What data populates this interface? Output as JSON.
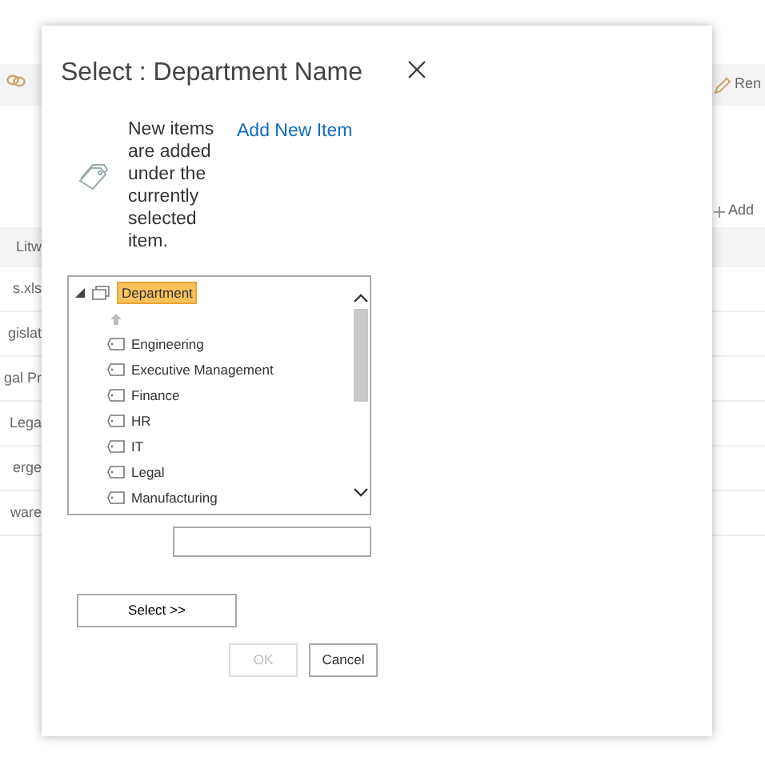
{
  "background": {
    "toolbar": {
      "right_label": "Ren"
    },
    "add_label": "Add",
    "header_label": "Litw",
    "rows": [
      "s.xls",
      "gislat",
      "gal Pr",
      "Lega",
      "erge",
      "ware"
    ]
  },
  "dialog": {
    "title": "Select : Department Name",
    "info_text": "New items are added under the currently selected item.",
    "add_link": "Add New Item",
    "tree": {
      "label": "Department",
      "expanded": true,
      "selected": true,
      "children": [
        {
          "label": "Engineering",
          "selected": false
        },
        {
          "label": "Executive Management",
          "selected": false
        },
        {
          "label": "Finance",
          "selected": false
        },
        {
          "label": "HR",
          "selected": false
        },
        {
          "label": "IT",
          "selected": false
        },
        {
          "label": "Legal",
          "selected": false
        },
        {
          "label": "Manufacturing",
          "selected": false
        }
      ]
    },
    "select_button": "Select >>",
    "buttons": [
      {
        "label": "OK",
        "disabled": true
      },
      {
        "label": "Cancel",
        "disabled": false
      }
    ]
  }
}
